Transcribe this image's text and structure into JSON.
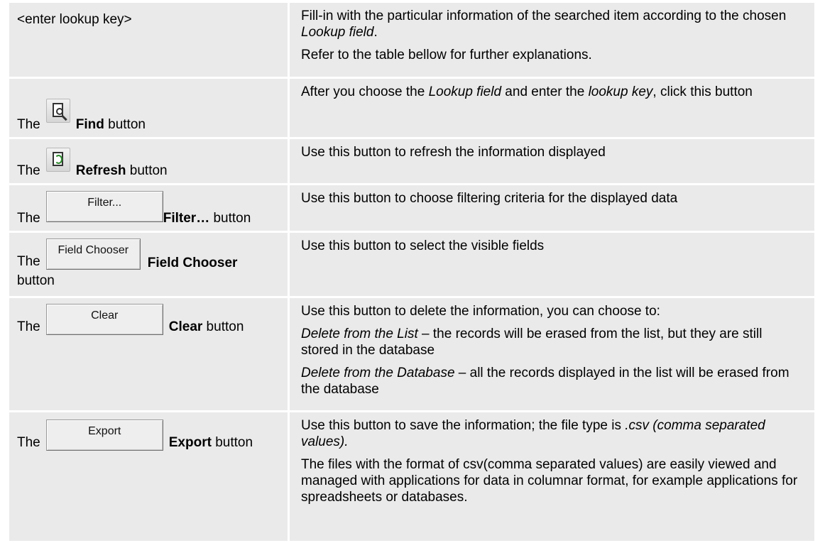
{
  "rows": [
    {
      "left": "<enter lookup key>",
      "right": [
        {
          "parts": [
            {
              "t": "Fill-in with the particular information of the searched item according to the chosen "
            },
            {
              "t": "Lookup field",
              "i": true
            },
            {
              "t": "."
            }
          ]
        },
        {
          "parts": [
            {
              "t": "Refer to the table bellow for further explanations."
            }
          ]
        }
      ]
    },
    {
      "the": "The",
      "bold": "Find",
      "suffix": " button",
      "icon": "find-icon",
      "right": [
        {
          "parts": [
            {
              "t": "After you choose the "
            },
            {
              "t": "Lookup field",
              "i": true
            },
            {
              "t": " and enter the "
            },
            {
              "t": "lookup key",
              "i": true
            },
            {
              "t": ", click this button"
            }
          ]
        }
      ]
    },
    {
      "the": "The",
      "bold": "Refresh",
      "suffix": " button",
      "icon": "refresh-icon",
      "right": [
        {
          "parts": [
            {
              "t": "Use this button to refresh the information displayed"
            }
          ]
        }
      ]
    },
    {
      "the": "The",
      "button_label": "Filter...",
      "bold": "Filter…",
      "suffix": " button",
      "right": [
        {
          "parts": [
            {
              "t": "Use this button to choose filtering criteria for the displayed data"
            }
          ]
        }
      ]
    },
    {
      "the": "The",
      "button_label": "Field Chooser",
      "bold": "Field Chooser",
      "suffix": "button",
      "right": [
        {
          "parts": [
            {
              "t": "Use this button to select the visible fields"
            }
          ]
        }
      ]
    },
    {
      "the": "The",
      "button_label": "Clear",
      "bold": "Clear",
      "suffix": " button",
      "right": [
        {
          "parts": [
            {
              "t": "Use this button to delete the information, you can choose to:"
            }
          ]
        },
        {
          "parts": [
            {
              "t": "Delete from the List",
              "i": true
            },
            {
              "t": " – the records will be erased from the list, but they are still stored in the database"
            }
          ]
        },
        {
          "parts": [
            {
              "t": "Delete from the Database",
              "i": true
            },
            {
              "t": " – all the records displayed in the list will be erased from the database"
            }
          ]
        }
      ]
    },
    {
      "the": "The",
      "button_label": "Export",
      "bold": "Export",
      "suffix": " button",
      "right": [
        {
          "parts": [
            {
              "t": "Use this button to save the information; the file type is "
            },
            {
              "t": ".csv (comma separated values).",
              "i": true
            }
          ]
        },
        {
          "parts": [
            {
              "t": "The files with the format of csv(comma separated values) are easily viewed and managed with applications for data in columnar format, for example applications for spreadsheets or databases."
            }
          ]
        }
      ]
    }
  ]
}
